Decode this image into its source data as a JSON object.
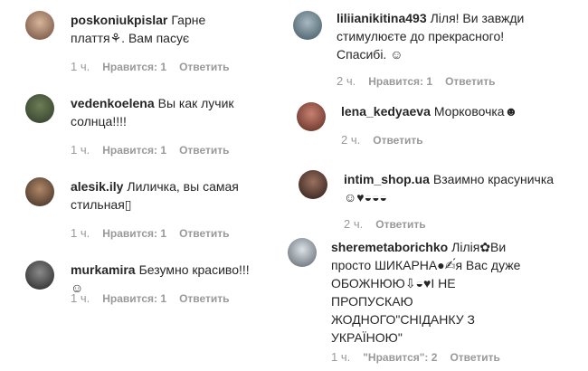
{
  "left_comments": [
    {
      "username": "poskoniukpislar",
      "text": "Гарне плаття⚘. Вам пасує",
      "time": "1 ч.",
      "likes": "Нравится: 1",
      "reply": "Ответить",
      "avatar_colors": [
        "#c59a7a",
        "#6b4a3a"
      ]
    },
    {
      "username": "vedenkoelena",
      "text": "Вы как лучик солнца!!!!",
      "time": "1 ч.",
      "likes": "Нравится: 1",
      "reply": "Ответить",
      "avatar_colors": [
        "#4a5a3a",
        "#2d3a2a"
      ]
    },
    {
      "username": "alesik.ily",
      "text": "Лиличка, вы самая стильная▯",
      "time": "1 ч.",
      "likes": "Нравится: 1",
      "reply": "Ответить",
      "avatar_colors": [
        "#7a5a44",
        "#3a2a20"
      ]
    },
    {
      "username": "murkamira",
      "text": "Безумно красиво!!!☺",
      "time": "1 ч.",
      "likes": "Нравится: 1",
      "reply": "Ответить",
      "avatar_colors": [
        "#555555",
        "#222222"
      ]
    }
  ],
  "right_comments": [
    {
      "username": "liliianikitina493",
      "text": "Ліля! Ви завжди стимулюєте до прекрасного! Спасибі. ☺",
      "time": "2 ч.",
      "likes": "Нравится: 1",
      "reply": "Ответить",
      "avatar_colors": [
        "#8aa0a8",
        "#3d5560"
      ]
    },
    {
      "username": "lena_kedyaeva",
      "text": "Морковочка☻",
      "time": "2 ч.",
      "likes": "",
      "reply": "Ответить",
      "avatar_colors": [
        "#b06a55",
        "#5a2a20"
      ]
    },
    {
      "username": "intim_shop.ua",
      "text": "Взаимно красуничка☺♥◒◒◒",
      "time": "2 ч.",
      "likes": "",
      "reply": "Ответить",
      "avatar_colors": [
        "#6a4a40",
        "#2a1a15"
      ]
    },
    {
      "username": "sheremetaborichko",
      "text": "Лілія✿Ви просто ШИКАРНА●✍́я Вас дуже ОБОЖНЮЮ⇩◒♥І НЕ ПРОПУСКАЮ ЖОДНОГО\"СНІДАНКУ З УКРАЇНОЮ\"",
      "time": "1 ч.",
      "likes": "\"Нравится\": 2",
      "reply": "Ответить",
      "avatar_colors": [
        "#b8c0c8",
        "#5a6068"
      ]
    }
  ]
}
